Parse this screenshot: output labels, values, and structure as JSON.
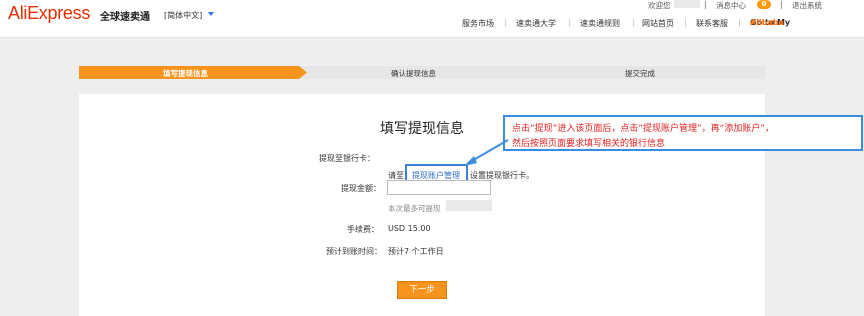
{
  "header": {
    "logo": "AliExpress",
    "logo_sub": "全球速卖通",
    "language": "[简体中文]",
    "welcome": "欢迎您",
    "messages": "消息中心",
    "message_count": "0",
    "logout": "退出系统",
    "nav": [
      "服务市场",
      "速卖通大学",
      "速卖通规则",
      "网站首页",
      "联系客服"
    ],
    "goto_prefix": "Go to My ",
    "goto_brand": "Alibaba",
    "goto_suffix": " »"
  },
  "steps": [
    {
      "label": "填写提现信息",
      "active": true
    },
    {
      "label": "确认提现信息",
      "active": false
    },
    {
      "label": "提交完成",
      "active": false
    }
  ],
  "form": {
    "title": "填写提现信息",
    "bank_label": "提现至银行卡：",
    "bank_prefix": "请至",
    "bank_link": "提现账户管理",
    "bank_suffix": "设置提现银行卡。",
    "amount_label": "提现金额：",
    "amount_value": "",
    "amount_hint": "本次最多可提现",
    "fee_label": "手续费：",
    "fee_value": "USD 15.00",
    "eta_label": "预计到账时间：",
    "eta_value": "预计7 个工作日",
    "next_button": "下一步"
  },
  "annotation": {
    "line1": "点击“提现”进入该页面后，点击“提现账户管理”，再“添加账户”，",
    "line2": "然后按照页面要求填写相关的银行信息"
  },
  "colors": {
    "brand": "#e62e04",
    "accent": "#f7941d",
    "link": "#2a6cc8",
    "annotation_border": "#3b8de0",
    "annotation_text": "#e02020"
  }
}
